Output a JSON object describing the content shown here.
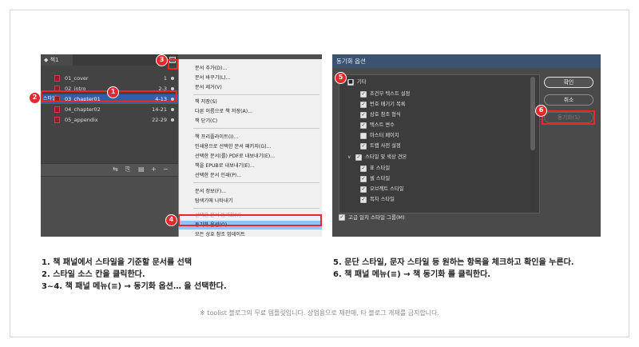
{
  "book_panel": {
    "tab_label": "책1",
    "source_marker": "스타일",
    "documents": [
      {
        "name": "01_cover",
        "pages": "1"
      },
      {
        "name": "02_intro",
        "pages": "2-3"
      },
      {
        "name": "03_chapter01",
        "pages": "4-13"
      },
      {
        "name": "04_chapter02",
        "pages": "14-21"
      },
      {
        "name": "05_appendix",
        "pages": "22-29"
      }
    ],
    "footer_icons": [
      "sync-icon",
      "link-icon",
      "print-icon",
      "add-icon",
      "remove-icon"
    ]
  },
  "book_menu": {
    "items": [
      "문서 추가(D)...",
      "문서 바꾸기(L)...",
      "문서 제거(V)",
      "책 저장(S)",
      "다른 이름으로 책 저장(A)...",
      "책 닫기(C)",
      "책 프리플라이트(I)...",
      "인쇄용으로 선택한 문서 패키지(G)...",
      "선택한 문서(를) PDF로 내보내기(E)...",
      "책을 EPUB로 내보내기(E)...",
      "선택한 문서 인쇄(P)...",
      "문서 정보(F)...",
      "탐색기에 나타내기",
      "선택한 문서 동기화(Y)",
      "동기화 옵션(O)...",
      "모든 상호 참조 업데이트"
    ]
  },
  "sync_dialog": {
    "title": "동기화 옵션",
    "group_other": "기타",
    "other_items": [
      "조건부 텍스트 설정",
      "번호 매기기 목록",
      "상호 참조 형식",
      "텍스트 변수",
      "마스터 페이지",
      "트랩 사전 설정"
    ],
    "group_styles": "스타일 및 색상 견본",
    "style_items": [
      "표 스타일",
      "셀 스타일",
      "오브젝트 스타일",
      "목차 스타일"
    ],
    "smart_match": "고급 일치 스타일 그룹(M)",
    "ok_label": "확인",
    "cancel_label": "취소",
    "sync_label": "동기화(S)"
  },
  "callouts": [
    "1",
    "2",
    "3",
    "4",
    "5",
    "6"
  ],
  "captions": {
    "left": [
      "1. 책 패널에서 스타일을 기준할 문서를 선택",
      "2. 스타일 소스 칸을 클릭한다.",
      "3~4. 책 패널 메뉴(≡) → 동기화 옵션… 을 선택한다."
    ],
    "right": [
      "5. 문단 스타일, 문자 스타일 등 원하는 항목을 체크하고 확인을 누른다.",
      "6. 책 패널 메뉴(≡) → 책 동기화 를 클릭한다."
    ]
  },
  "footer_note": "※ toolist 블로그의 무료 템플릿입니다. 상업용으로 재판매, 타 블로그 개재를 금지합니다."
}
